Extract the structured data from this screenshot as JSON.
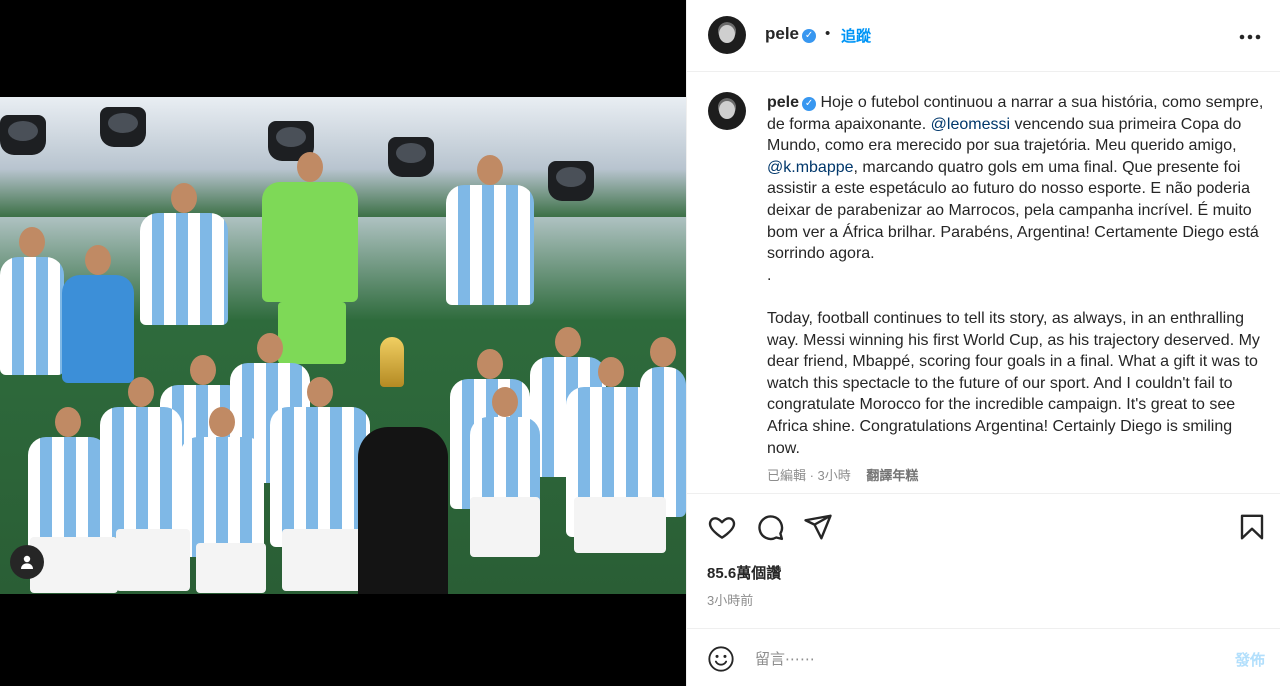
{
  "post": {
    "username": "pele",
    "verified": true,
    "separator": "•",
    "follow_label": "追蹤",
    "more_icon": "more-horizontal-icon"
  },
  "caption": {
    "pt_1": "Hoje o futebol continuou a narrar a sua história, como sempre, de forma apaixonante. ",
    "mention_messi": "@leomessi",
    "pt_2": " vencendo sua primeira Copa do Mundo, como era merecido por sua trajetória. Meu querido amigo, ",
    "mention_mbappe": "@k.mbappe",
    "pt_3": ", marcando quatro gols em uma final. Que presente foi assistir a este espetáculo ao futuro do nosso esporte. E não poderia deixar de parabenizar ao Marrocos, pela campanha incrível. É muito bom ver a África brilhar. Parabéns, Argentina! Certamente Diego está sorrindo agora.",
    "dot": ".",
    "en": "Today, football continues to tell its story, as always, in an enthralling way. Messi winning his first World Cup, as his trajectory deserved. My dear friend, Mbappé, scoring four goals in a final. What a gift it was to watch this spectacle to the future of our sport. And I couldn't fail to congratulate Morocco for the incredible campaign. It's great to see Africa shine. Congratulations Argentina! Certainly Diego is smiling now.",
    "edited": "已編輯 · 3小時",
    "translate": "翻譯年糕"
  },
  "stats": {
    "views": "85.6萬個讚",
    "time": "3小時前"
  },
  "comment": {
    "placeholder": "留言⋯⋯",
    "post_label": "發佈"
  },
  "colors": {
    "link": "#00376b",
    "accent": "#0095f6",
    "verified": "#3897f0",
    "post_disabled": "#b2dffc"
  }
}
